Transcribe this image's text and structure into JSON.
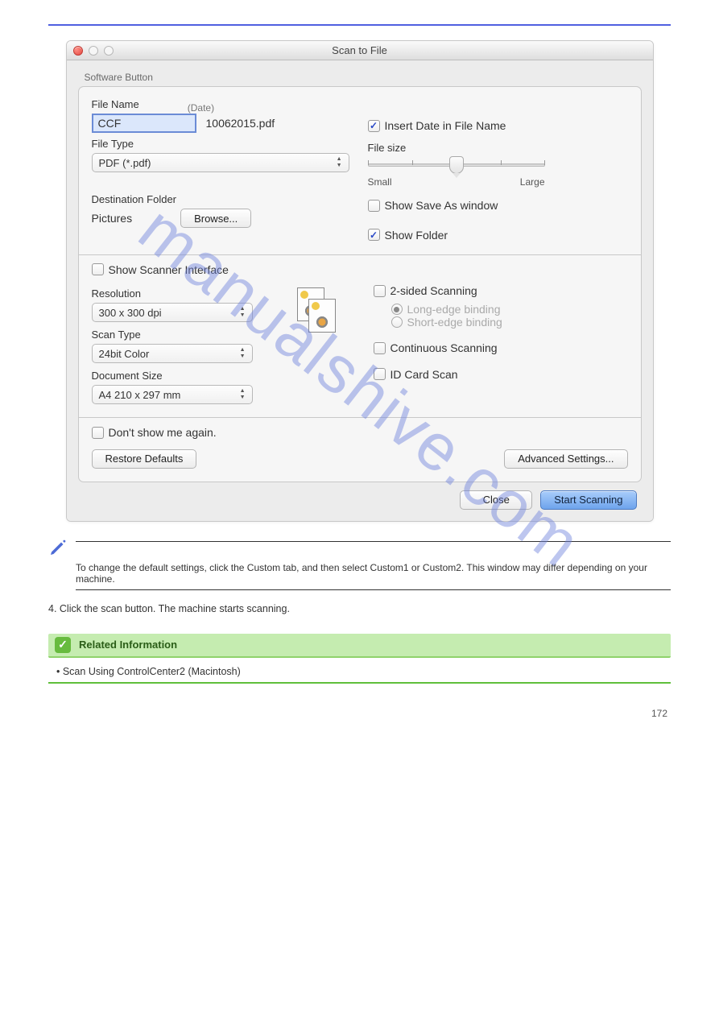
{
  "watermark": "manualshive.com",
  "dialog": {
    "title": "Scan to File",
    "section_label": "Software Button",
    "filename": {
      "label": "File Name",
      "date_label": "(Date)",
      "value": "CCF",
      "preview": "10062015.pdf"
    },
    "filetype": {
      "label": "File Type",
      "value": "PDF (*.pdf)"
    },
    "destination": {
      "label": "Destination Folder",
      "value": "Pictures",
      "browse": "Browse..."
    },
    "insert_date": {
      "label": "Insert Date in File Name",
      "checked": true
    },
    "filesize": {
      "label": "File size",
      "min": "Small",
      "max": "Large"
    },
    "show_save_as": {
      "label": "Show Save As window",
      "checked": false
    },
    "show_folder": {
      "label": "Show Folder",
      "checked": true
    },
    "show_scanner_if": {
      "label": "Show Scanner Interface",
      "checked": false
    },
    "resolution": {
      "label": "Resolution",
      "value": "300 x 300 dpi"
    },
    "scan_type": {
      "label": "Scan Type",
      "value": "24bit Color"
    },
    "doc_size": {
      "label": "Document Size",
      "value": "A4 210 x 297 mm"
    },
    "two_sided": {
      "label": "2-sided Scanning",
      "checked": false,
      "long_edge": "Long-edge binding",
      "short_edge": "Short-edge binding"
    },
    "continuous": {
      "label": "Continuous Scanning",
      "checked": false
    },
    "id_card": {
      "label": "ID Card Scan",
      "checked": false
    },
    "dont_show": {
      "label": "Don't show me again.",
      "checked": false
    },
    "restore": "Restore Defaults",
    "advanced": "Advanced Settings...",
    "close": "Close",
    "start": "Start Scanning"
  },
  "note": "To change the default settings, click the Custom tab, and then select Custom1 or Custom2. This window may differ depending on your machine.",
  "step": "4. Click the scan button. The machine starts scanning.",
  "related": {
    "title": "Related Information",
    "link": "• Scan Using ControlCenter2 (Macintosh)"
  },
  "page_number": "172"
}
